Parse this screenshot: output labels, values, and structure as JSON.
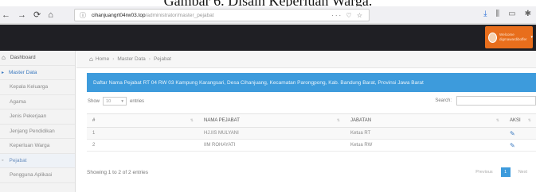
{
  "caption": "Gambar 6. Disain Keperluan Warga.",
  "browser": {
    "back": "←",
    "forward": "→",
    "reload": "⟳",
    "home": "⌂",
    "host": "cihanjuangrt04rw03.top",
    "path": "/administrator/master_pejabat",
    "url_actions": "··· ♡ ☆"
  },
  "user": {
    "name_line1": "Welcome",
    "name_line2": "digmawardiboffer"
  },
  "sidebar": {
    "items": [
      {
        "label": "Dashboard"
      },
      {
        "label": "Master Data"
      },
      {
        "label": "Kepala Keluarga"
      },
      {
        "label": "Agama"
      },
      {
        "label": "Jenis Pekerjaan"
      },
      {
        "label": "Jenjang Pendidikan"
      },
      {
        "label": "Keperluan Warga"
      },
      {
        "label": "Pejabat"
      },
      {
        "label": "Pengguna Aplikasi"
      }
    ]
  },
  "breadcrumb": {
    "home": "Home",
    "master": "Master Data",
    "current": "Pejabat"
  },
  "panel": {
    "title": "Daftar Nama Pejabat RT 04 RW 03 Kampung Karangsari, Desa Cihanjuang, Kecamatan Parongpong, Kab. Bandung Barat, Provinsi Jawa Barat"
  },
  "controls": {
    "show_label": "Show",
    "show_value": "10",
    "entries_label": "entries",
    "search_label": "Search:"
  },
  "table": {
    "headers": [
      "#",
      "NAMA PEJABAT",
      "JABATAN",
      "AKSI"
    ],
    "rows": [
      {
        "no": "1",
        "nama": "HJ.IIS MULYANI",
        "jabatan": "Ketua RT"
      },
      {
        "no": "2",
        "nama": "IIM ROHAYATI",
        "jabatan": "Ketua RW"
      }
    ]
  },
  "footer": {
    "info": "Showing 1 to 2 of 2 entries",
    "prev": "Previous",
    "page": "1",
    "next": "Next"
  },
  "colors": {
    "accent": "#3d9bdc",
    "user_box": "#e86e1c",
    "header_dark": "#1f1f24"
  }
}
